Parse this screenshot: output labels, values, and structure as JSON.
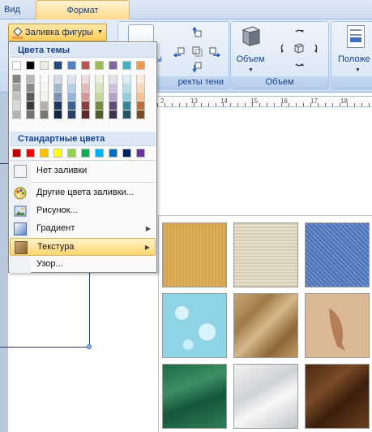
{
  "tabs": {
    "view": "Вид",
    "format": "Формат"
  },
  "toolbar": {
    "fill_button": "Заливка фигуры"
  },
  "ribbon": {
    "shadow_group_label_partial": "ректы тени",
    "shadow_cut_text": "ы",
    "volume_button": "Объем",
    "volume_group_label": "Объем",
    "position_button": "Положе"
  },
  "ruler": {
    "numbers": [
      "2",
      "13",
      "14",
      "15",
      "16",
      "17",
      "18"
    ]
  },
  "menu": {
    "theme_header": "Цвета темы",
    "standard_header": "Стандартные цвета",
    "items": [
      {
        "label": "Нет заливки",
        "icon": "no-fill-icon",
        "submenu": false
      },
      {
        "label": "Другие цвета заливки...",
        "icon": "palette-icon",
        "submenu": false
      },
      {
        "label": "Рисунок...",
        "icon": "picture-icon",
        "submenu": false
      },
      {
        "label": "Градиент",
        "icon": "gradient-icon",
        "submenu": true
      },
      {
        "label": "Текстура",
        "icon": "texture-icon",
        "submenu": true
      },
      {
        "label": "Узор...",
        "icon": "",
        "submenu": false
      }
    ]
  },
  "colors": {
    "theme_top": [
      "#ffffff",
      "#000000",
      "#eeece1",
      "#1f497d",
      "#4f81bd",
      "#c0504d",
      "#9bbb59",
      "#8064a2",
      "#4bacc6",
      "#f79646"
    ],
    "standard": [
      "#c00000",
      "#ff0000",
      "#ffc000",
      "#ffff00",
      "#92d050",
      "#00b050",
      "#00b0f0",
      "#0070c0",
      "#002060",
      "#7030a0"
    ],
    "accent_highlight": "#ffd66f"
  },
  "textures": [
    "papyrus-texture",
    "canvas-texture",
    "denim-texture",
    "water-droplets-texture",
    "paper-bag-texture",
    "fish-fossil-texture",
    "green-marble-texture",
    "white-marble-texture",
    "brown-marble-texture"
  ]
}
